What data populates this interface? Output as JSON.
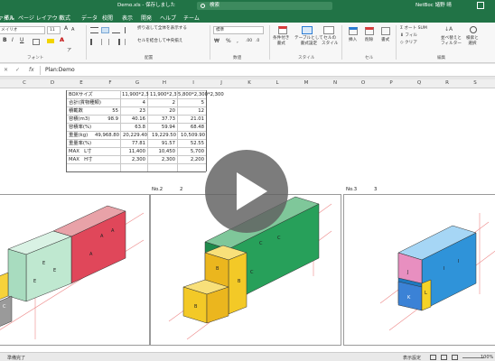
{
  "app": {
    "doc_title": "Demo.xls - 保存しました",
    "search_placeholder": "検索",
    "user_name": "NetBoc 諸野 晴"
  },
  "menu": [
    "ファイル",
    "挿入",
    "ページ レイアウト",
    "数式",
    "データ",
    "校閲",
    "表示",
    "開発",
    "ヘルプ",
    "チーム"
  ],
  "ribbon": {
    "font_name": "メイリオ",
    "font_size": "11",
    "wrap_text": "折り返して全体を表示する",
    "merge_center": "セルを結合して中央揃え",
    "number_format": "標準",
    "cond_format": "条件付き\n書式",
    "as_table": "テーブルとして\n書式設定",
    "cell_style": "セルの\nスタイル",
    "insert": "挿入",
    "delete": "削除",
    "format": "書式",
    "autosum": "オート SUM",
    "fill": "フィル",
    "clear": "クリア",
    "sort_filter": "並べ替えと\nフィルター",
    "find_select": "検索と\n選択",
    "groups": [
      "フォント",
      "配置",
      "数値",
      "スタイル",
      "セル",
      "編集"
    ]
  },
  "formula_bar": {
    "fx": "fx",
    "content": "Plan:Demo"
  },
  "columns": [
    "C",
    "D",
    "E",
    "F",
    "G",
    "H",
    "I",
    "J",
    "K",
    "L",
    "M",
    "N",
    "O",
    "P",
    "Q",
    "R",
    "S"
  ],
  "table": {
    "rows": [
      [
        "BOXサイズ",
        "",
        "11,900*2,3",
        "11,900*2,3",
        "5,800*2,300*2,300"
      ],
      [
        "合計(貨物種類)",
        "",
        "4",
        "2",
        "5"
      ],
      [
        "積載数",
        "55",
        "23",
        "20",
        "12"
      ],
      [
        "容積(m3)",
        "98.9",
        "40.16",
        "37.73",
        "21.01"
      ],
      [
        "容積率(%)",
        "",
        "63.8",
        "59.94",
        "68.48"
      ],
      [
        "重量(kg)",
        "49,968.80",
        "20,229.40",
        "19,229.50",
        "10,509.90"
      ],
      [
        "重量率(%)",
        "",
        "77.81",
        "91.57",
        "52.55"
      ],
      [
        "MAX　L寸",
        "",
        "11,400",
        "10,450",
        "5,700"
      ],
      [
        "MAX　H寸",
        "",
        "2,300",
        "2,300",
        "2,200"
      ]
    ]
  },
  "panes": {
    "no2_label": "No.2",
    "no2_value": "2",
    "no3_label": "No.3",
    "no3_value": "3"
  },
  "boxes": {
    "red": "A",
    "green_light": "E",
    "gray": "C",
    "yellow": "B",
    "green": "C",
    "blue": "I",
    "pink": "J",
    "navy": "K",
    "yellow2": "L"
  },
  "status": {
    "ready": "準備完了",
    "display_settings": "表示設定",
    "zoom": "100%"
  }
}
